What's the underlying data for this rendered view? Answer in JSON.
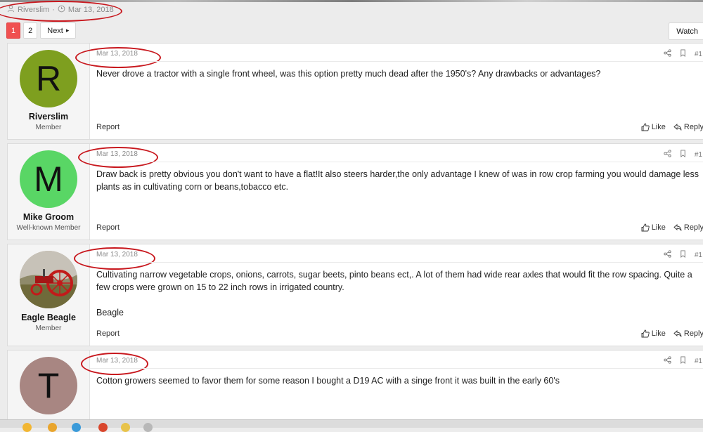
{
  "thread_meta": {
    "author": "Riverslim",
    "separator": "·",
    "date": "Mar 13, 2018"
  },
  "pagination": {
    "pages": [
      "1",
      "2"
    ],
    "current": "1",
    "next_label": "Next",
    "next_arrow": "▸"
  },
  "watch_label": "Watch",
  "posts": [
    {
      "username": "Riverslim",
      "user_title": "Member",
      "avatar_letter": "R",
      "avatar_color": "#7e9f1f",
      "date": "Mar 13, 2018",
      "number": "#1",
      "paragraphs": [
        "Never drove a tractor with a single front wheel, was this option pretty much dead after the 1950's? Any drawbacks or advantages?"
      ],
      "report_label": "Report",
      "like_label": "Like",
      "reply_label": "Reply"
    },
    {
      "username": "Mike Groom",
      "user_title": "Well-known Member",
      "avatar_letter": "M",
      "avatar_color": "#59d665",
      "date": "Mar 13, 2018",
      "number": "#1",
      "paragraphs": [
        "Draw back is pretty obvious you don't want to have a flat!It also steers harder,the only advantage I knew of was in row crop farming you would damage less plants as in cultivating corn or beans,tobacco etc."
      ],
      "report_label": "Report",
      "like_label": "Like",
      "reply_label": "Reply"
    },
    {
      "username": "Eagle Beagle",
      "user_title": "Member",
      "avatar_letter": "",
      "avatar_color": "#8a5a3c",
      "date": "Mar 13, 2018",
      "number": "#1",
      "paragraphs": [
        "Cultivating narrow vegetable crops, onions, carrots, sugar beets, pinto beans ect,. A lot of them had wide rear axles that would fit the row spacing. Quite a few crops were grown on 15 to 22 inch rows in irrigated country.",
        "Beagle"
      ],
      "report_label": "Report",
      "like_label": "Like",
      "reply_label": "Reply"
    },
    {
      "username": "",
      "user_title": "",
      "avatar_letter": "T",
      "avatar_color": "#a88682",
      "date": "Mar 13, 2018",
      "number": "#1",
      "paragraphs": [
        "Cotton growers seemed to favor them for some reason I bought a D19 AC with a singe front it was built in the early 60's"
      ],
      "report_label": "",
      "like_label": "",
      "reply_label": ""
    }
  ],
  "colors": {
    "annotation_red": "#c8181e",
    "page_active": "#f05050",
    "date_grey": "#8a8a8a"
  },
  "icons": [
    "user-icon",
    "clock-icon",
    "share-icon",
    "bookmark-icon",
    "like-icon",
    "reply-icon"
  ]
}
